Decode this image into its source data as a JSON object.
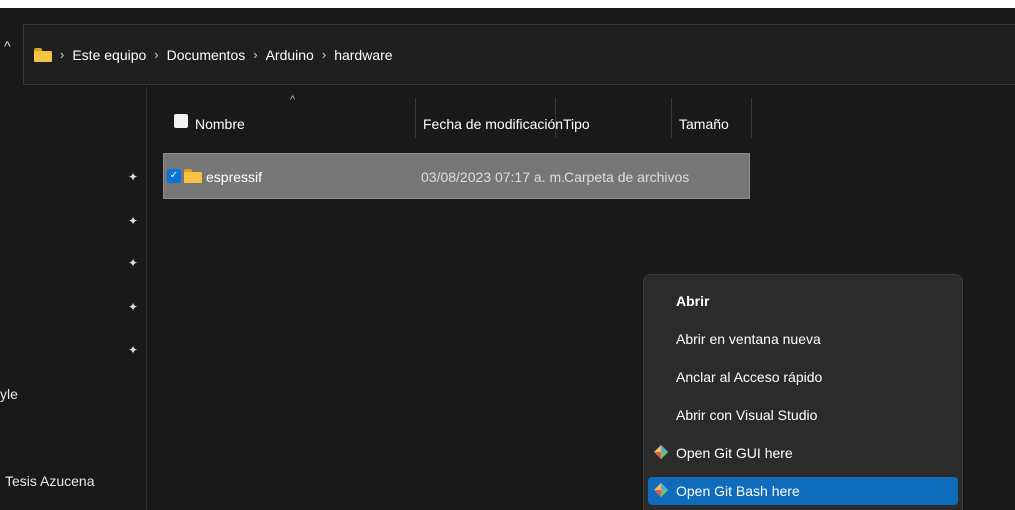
{
  "breadcrumb": [
    "Este equipo",
    "Documentos",
    "Arduino",
    "hardware"
  ],
  "sidebar": {
    "fragments": [
      "yle",
      "Tesis Azucena"
    ]
  },
  "columns": {
    "name": "Nombre",
    "date": "Fecha de modificación",
    "type": "Tipo",
    "size": "Tamaño"
  },
  "files": [
    {
      "name": "espressif",
      "date": "03/08/2023 07:17 a. m.",
      "type": "Carpeta de archivos",
      "size": "",
      "selected": true
    }
  ],
  "context_menu": {
    "items": [
      {
        "label": "Abrir",
        "bold": true
      },
      {
        "label": "Abrir en ventana nueva"
      },
      {
        "label": "Anclar al Acceso rápido"
      },
      {
        "label": "Abrir con Visual Studio"
      },
      {
        "label": "Open Git GUI here",
        "icon": "git-icon"
      },
      {
        "label": "Open Git Bash here",
        "icon": "git-icon",
        "highlighted": true
      }
    ]
  },
  "colors": {
    "accent": "#0f6cbd",
    "folder": "#f6c343",
    "selection": "#767676",
    "menu_bg": "#2b2b2b"
  }
}
